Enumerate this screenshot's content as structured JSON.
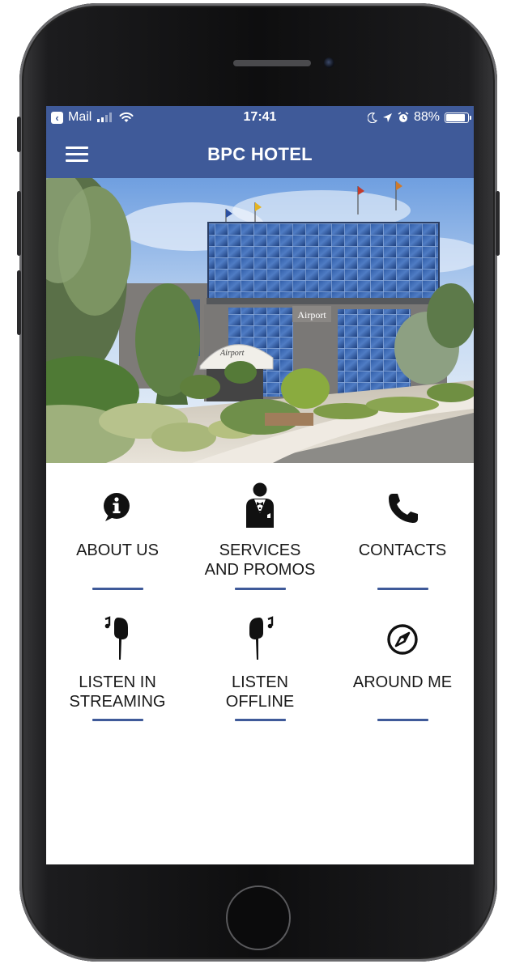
{
  "status_bar": {
    "back_app": "Mail",
    "time": "17:41",
    "battery": "88%",
    "battery_level": 0.88
  },
  "app_bar": {
    "title": "BPC HOTEL",
    "menu_icon": "hamburger-menu-icon"
  },
  "hero": {
    "sign_text": "Airport",
    "canopy_text": "Airport"
  },
  "menu_tiles": [
    {
      "label": "ABOUT US",
      "icon": "info-icon"
    },
    {
      "label": "SERVICES\nAND PROMOS",
      "icon": "butler-icon"
    },
    {
      "label": "CONTACTS",
      "icon": "phone-icon"
    },
    {
      "label": "LISTEN IN\nSTREAMING",
      "icon": "earphone-music-icon"
    },
    {
      "label": "LISTEN\nOFFLINE",
      "icon": "earphone-music-icon"
    },
    {
      "label": "AROUND ME",
      "icon": "compass-icon"
    }
  ],
  "colors": {
    "primary": "#3f5a99",
    "text": "#1a1a1a",
    "background": "#ffffff"
  }
}
